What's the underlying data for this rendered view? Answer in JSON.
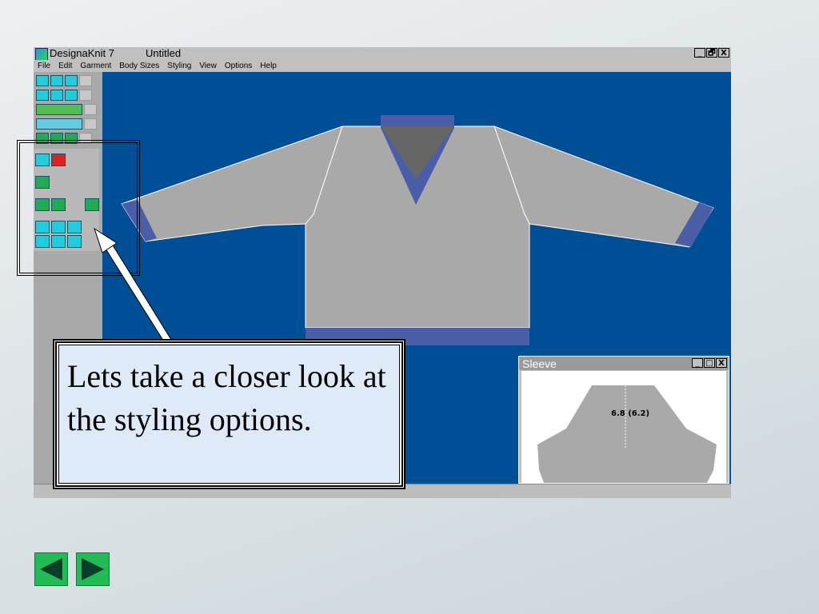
{
  "window": {
    "app_name": "DesignaKnit 7",
    "document": "Untitled",
    "minimize": "_",
    "maximize": "🗗",
    "close": "X"
  },
  "menu": [
    "File",
    "Edit",
    "Garment",
    "Body Sizes",
    "Styling",
    "View",
    "Options",
    "Help"
  ],
  "callout": {
    "text": "Lets take a closer look at the styling options."
  },
  "sleeve_window": {
    "title": "Sleeve",
    "measurement": "6.8  (6.2)"
  },
  "colors": {
    "canvas": "#004f96",
    "garment": "#a9a9a9",
    "rib": "#4a5ea8",
    "neck": "#666666",
    "nav": "#22bb55"
  },
  "icons": {
    "prev": "triangle-left",
    "next": "triangle-right"
  }
}
